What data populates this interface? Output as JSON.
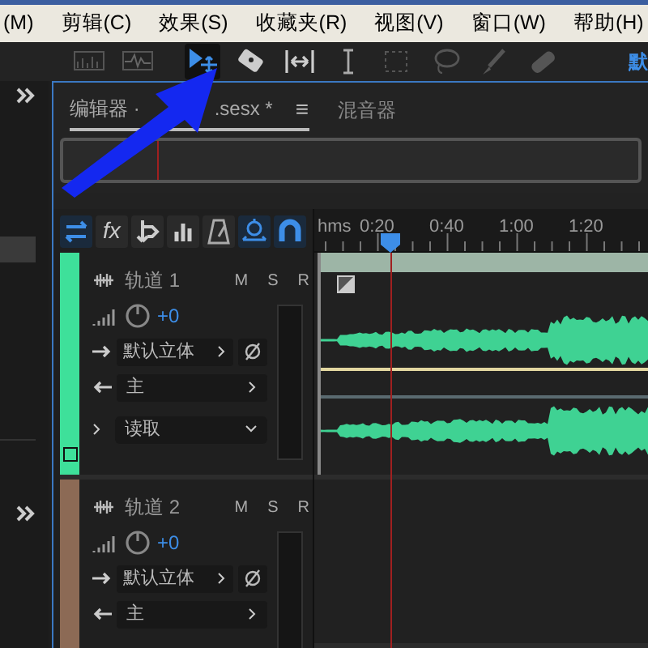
{
  "menu": [
    "(M)",
    "剪辑(C)",
    "效果(S)",
    "收藏夹(R)",
    "视图(V)",
    "窗口(W)",
    "帮助(H)"
  ],
  "tools": [
    {
      "kind": "spectral",
      "selected": false
    },
    {
      "kind": "waveform",
      "selected": false
    },
    {
      "kind": "move",
      "selected": true
    },
    {
      "kind": "razor",
      "selected": false
    },
    {
      "kind": "slip",
      "selected": false
    },
    {
      "kind": "ibeam",
      "selected": false
    },
    {
      "kind": "marquee",
      "selected": false
    },
    {
      "kind": "lasso",
      "selected": false
    },
    {
      "kind": "brush",
      "selected": false
    },
    {
      "kind": "heal",
      "selected": false
    }
  ],
  "workspace_label": "默",
  "editor_tabs": [
    {
      "label": "编辑器 ·",
      "label_tail": ".sesx *",
      "selected": true,
      "menu": "≡"
    },
    {
      "label": "混音器",
      "selected": false
    }
  ],
  "track_tools": [
    {
      "kind": "swap",
      "on": true
    },
    {
      "kind": "fx",
      "label": "fx",
      "on": false
    },
    {
      "kind": "send",
      "on": false
    },
    {
      "kind": "eq",
      "on": false
    },
    {
      "kind": "metronome",
      "on": false
    },
    {
      "kind": "stretch",
      "on": true
    },
    {
      "kind": "magnet",
      "on": true
    }
  ],
  "ruler": {
    "unit": "hms",
    "ticks": [
      "0:20",
      "0:40",
      "1:00",
      "1:20"
    ]
  },
  "tracks": [
    {
      "name": "轨道 1",
      "color": "#3ee09a",
      "buttons": [
        "M",
        "S",
        "R"
      ],
      "volume": "+0",
      "input": "默认立体",
      "output": "主",
      "automation": "读取"
    },
    {
      "name": "轨道 2",
      "color": "#8c6a55",
      "buttons": [
        "M",
        "S",
        "R"
      ],
      "volume": "+0",
      "input": "默认立体",
      "output": "主"
    }
  ]
}
